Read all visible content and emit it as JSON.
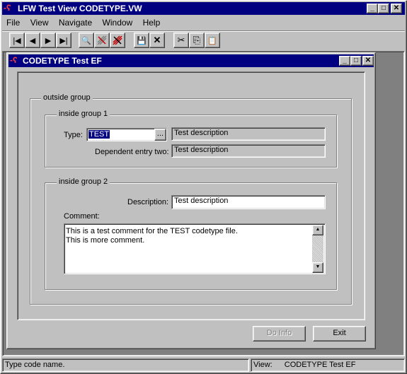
{
  "app": {
    "title": "LFW Test View CODETYPE.VW",
    "logo_text": "-ʕ"
  },
  "menu": [
    "File",
    "View",
    "Navigate",
    "Window",
    "Help"
  ],
  "window_controls": {
    "minimize": "_",
    "maximize": "□",
    "close": "✕"
  },
  "toolbar": {
    "first": "|◀",
    "prev": "◀",
    "next": "▶",
    "last": "▶|",
    "find": "🔍",
    "save": "💾",
    "delete": "✕",
    "cut": "✂",
    "copy": "⎘",
    "paste": "📋"
  },
  "child": {
    "title": "CODETYPE Test EF",
    "outside_group": "outside group",
    "group1": {
      "legend": "inside group 1",
      "type_label": "Type:",
      "type_value": "TEST",
      "lookup_button": "...",
      "type_desc": "Test description",
      "dep_label": "Dependent entry two:",
      "dep_value": "Test description"
    },
    "group2": {
      "legend": "inside group 2",
      "desc_label": "Description:",
      "desc_value": "Test description",
      "comment_label": "Comment:",
      "comment_line1": "This is a test comment for the TEST codetype file.",
      "comment_line2": "This is more comment."
    },
    "do_info_button": "Do Info",
    "exit_button": "Exit"
  },
  "status": {
    "message": "Type code name.",
    "view_label": "View:",
    "view_value": "CODETYPE Test EF"
  },
  "colors": {
    "titlebar": "#000080",
    "face": "#c0c0c0",
    "mdi_bg": "#808080"
  }
}
